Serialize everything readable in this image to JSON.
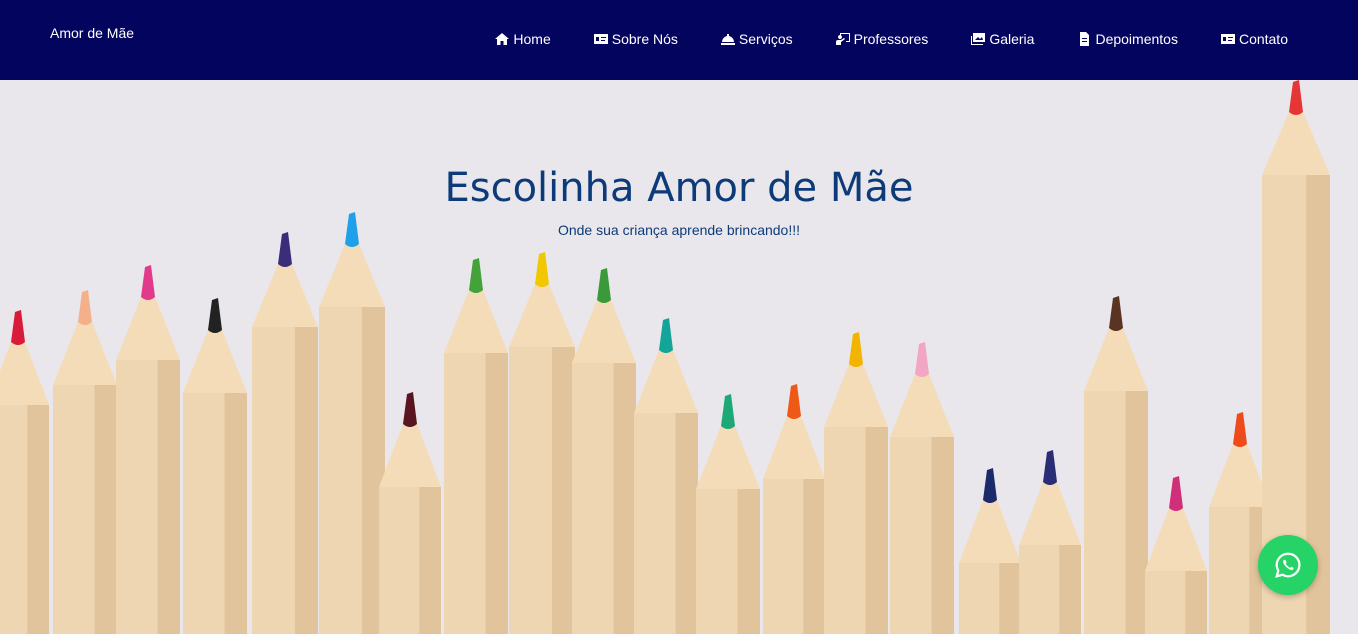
{
  "navbar": {
    "brand": "Amor de Mãe",
    "items": [
      {
        "label": "Home",
        "icon": "home-icon"
      },
      {
        "label": "Sobre Nós",
        "icon": "id-card-icon"
      },
      {
        "label": "Serviços",
        "icon": "service-bell-icon"
      },
      {
        "label": "Professores",
        "icon": "chalkboard-teacher-icon"
      },
      {
        "label": "Galeria",
        "icon": "images-icon"
      },
      {
        "label": "Depoimentos",
        "icon": "file-icon"
      },
      {
        "label": "Contato",
        "icon": "address-card-icon"
      }
    ],
    "background": "#03045e"
  },
  "hero": {
    "title": "Escolinha Amor de Mãe",
    "subtitle": "Onde sua criança aprende brincando!!!",
    "text_color": "#0d3b7a",
    "background": "#e9e7ec"
  },
  "whatsapp_button": {
    "icon": "whatsapp-icon",
    "color": "#25d366"
  }
}
